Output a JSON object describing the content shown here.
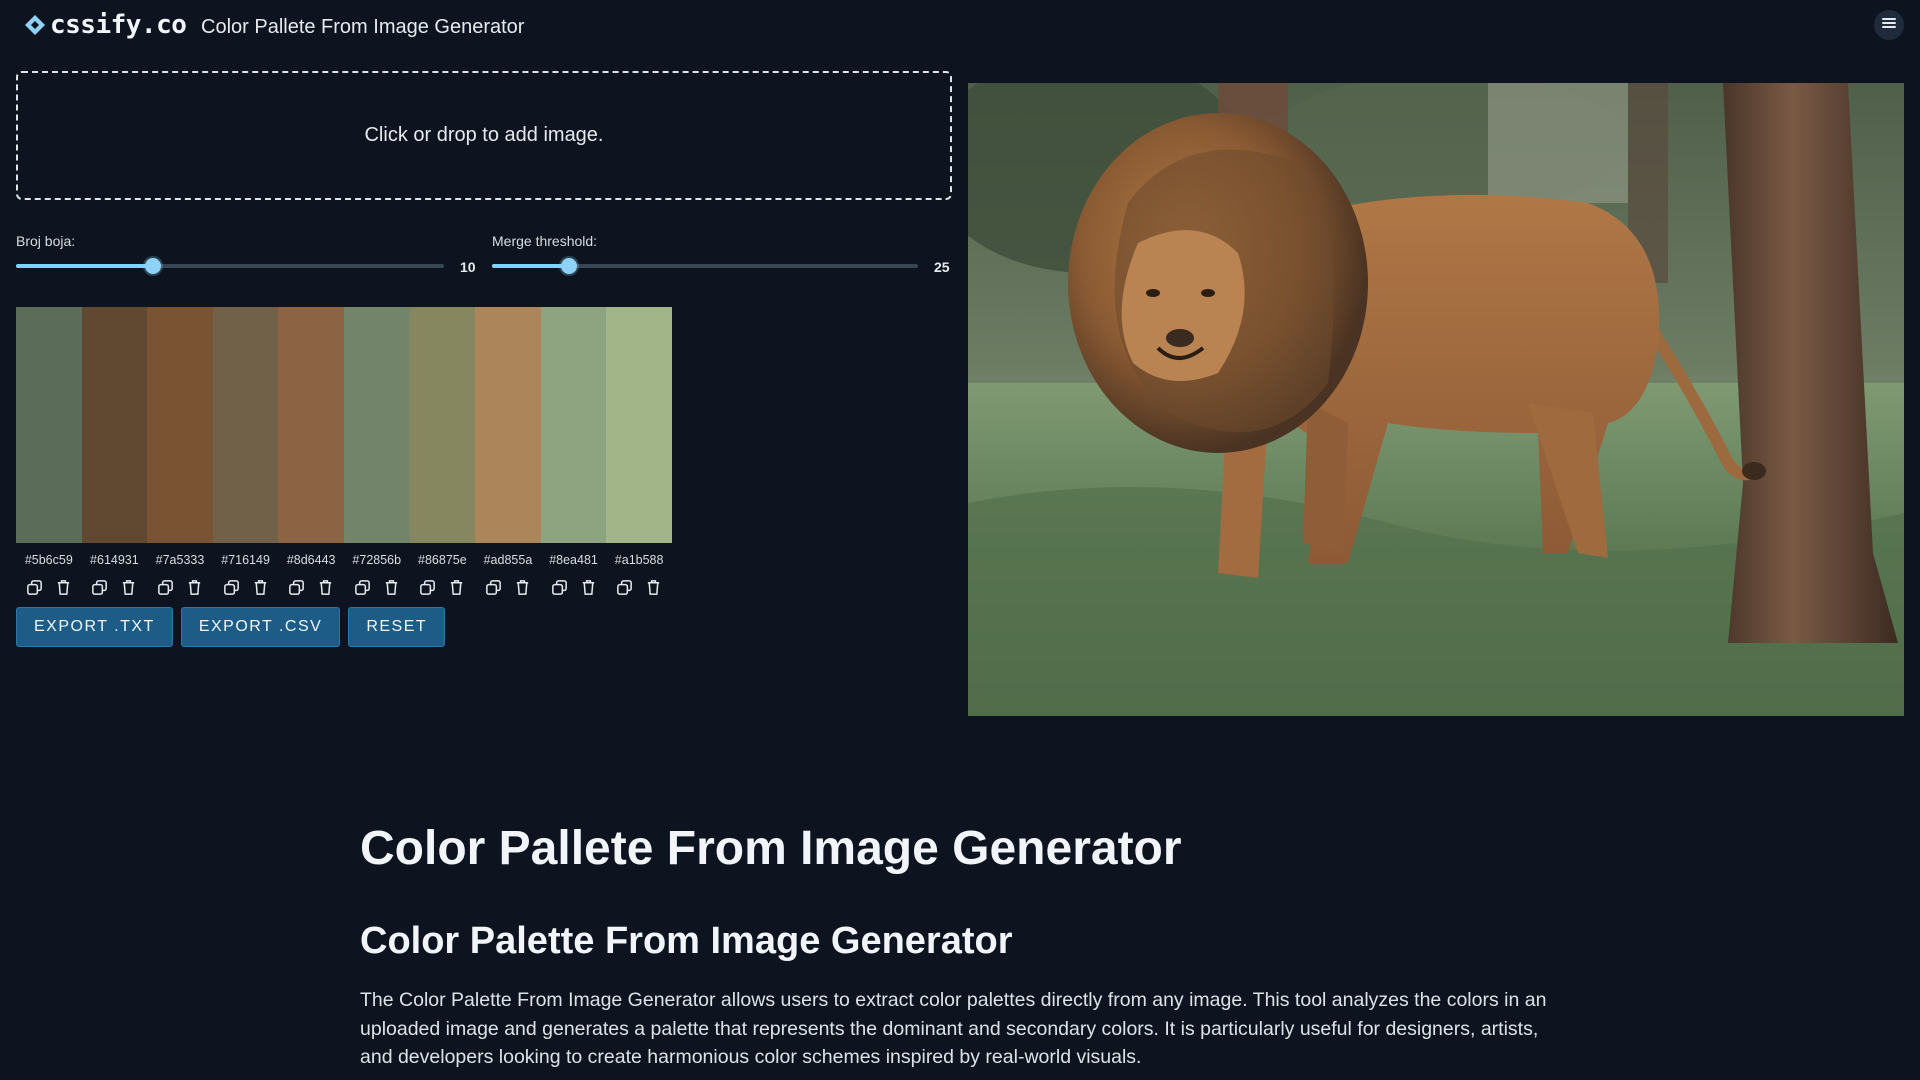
{
  "header": {
    "logo_text": "cssify.co",
    "app_title": "Color Pallete From Image Generator",
    "menu_icon": "hamburger-menu-icon"
  },
  "dropzone": {
    "label": "Click or drop to add image."
  },
  "sliders": {
    "color_count": {
      "label": "Broj boja:",
      "value": "10",
      "fraction": 0.32
    },
    "merge_threshold": {
      "label": "Merge threshold:",
      "value": "25",
      "fraction": 0.18
    }
  },
  "palette": {
    "swatches": [
      {
        "hex": "#5b6c59"
      },
      {
        "hex": "#614931"
      },
      {
        "hex": "#7a5333"
      },
      {
        "hex": "#716149"
      },
      {
        "hex": "#8d6443"
      },
      {
        "hex": "#72856b"
      },
      {
        "hex": "#86875e"
      },
      {
        "hex": "#ad855a"
      },
      {
        "hex": "#8ea481"
      },
      {
        "hex": "#a1b588"
      }
    ],
    "copy_icon": "copy-icon",
    "delete_icon": "trash-icon"
  },
  "buttons": {
    "export_txt": "EXPORT .TXT",
    "export_csv": "EXPORT .CSV",
    "reset": "RESET"
  },
  "article": {
    "h1": "Color Pallete From Image Generator",
    "h2": "Color Palette From Image Generator",
    "paragraph": "The Color Palette From Image Generator allows users to extract color palettes directly from any image. This tool analyzes the colors in an uploaded image and generates a palette that represents the dominant and secondary colors. It is particularly useful for designers, artists, and developers looking to create harmonious color schemes inspired by real-world visuals."
  },
  "colors": {
    "background": "#0d1420",
    "accent": "#7dd3fc",
    "button_bg": "#1d5c86"
  }
}
